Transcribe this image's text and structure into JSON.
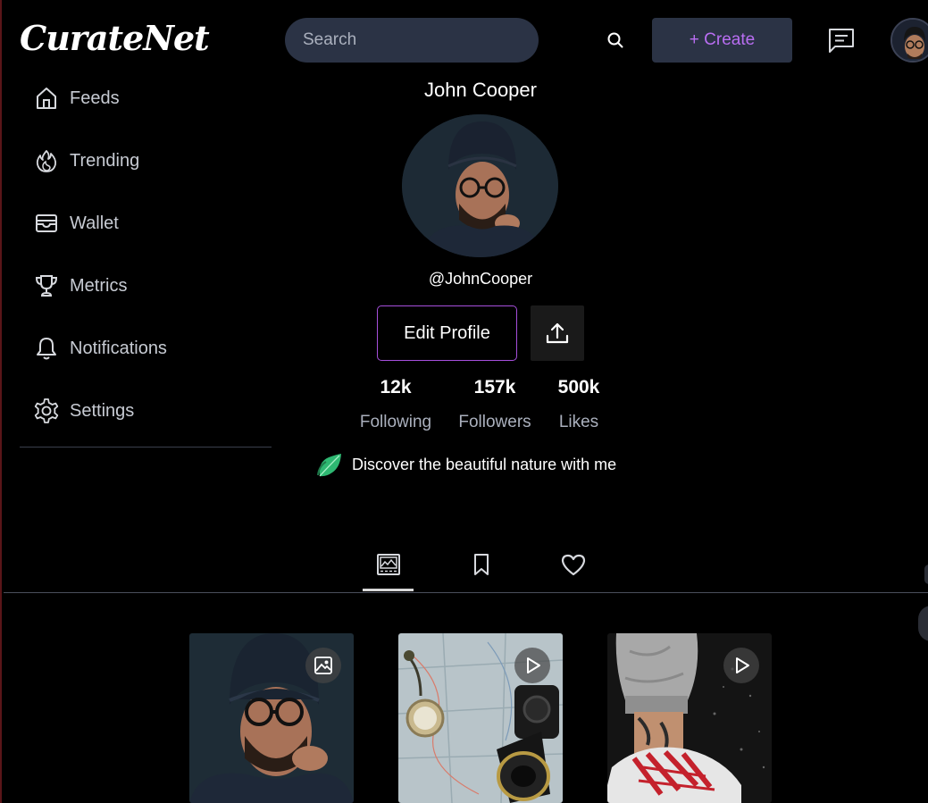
{
  "app": {
    "logo": "CurateNet"
  },
  "header": {
    "search_placeholder": "Search",
    "create_label": "+ Create",
    "icons": [
      "search-icon",
      "chat-icon",
      "avatar"
    ]
  },
  "sidebar": {
    "items": [
      {
        "label": "Feeds",
        "icon": "home-icon"
      },
      {
        "label": "Trending",
        "icon": "flame-icon"
      },
      {
        "label": "Wallet",
        "icon": "wallet-icon"
      },
      {
        "label": "Metrics",
        "icon": "trophy-icon"
      },
      {
        "label": "Notifications",
        "icon": "bell-icon"
      },
      {
        "label": "Settings",
        "icon": "gear-icon"
      }
    ]
  },
  "profile": {
    "name": "John Cooper",
    "handle": "@JohnCooper",
    "edit_label": "Edit Profile",
    "bio": "Discover the beautiful nature with me",
    "stats": [
      {
        "value": "12k",
        "label": "Following"
      },
      {
        "value": "157k",
        "label": "Followers"
      },
      {
        "value": "500k",
        "label": "Likes"
      }
    ]
  },
  "tabs": [
    {
      "icon": "gallery-icon",
      "active": true
    },
    {
      "icon": "bookmark-icon",
      "active": false
    },
    {
      "icon": "heart-icon",
      "active": false
    }
  ],
  "posts": [
    {
      "type": "image",
      "badge_icon": "image-icon",
      "subject": "portrait"
    },
    {
      "type": "video",
      "badge_icon": "play-icon",
      "subject": "map-camera"
    },
    {
      "type": "video",
      "badge_icon": "play-icon",
      "subject": "sneakers"
    }
  ],
  "colors": {
    "background": "#000000",
    "surface": "#2b3345",
    "accent": "#b96ef2",
    "edit_border": "#a64fdc",
    "muted_text": "#aab0bd"
  }
}
